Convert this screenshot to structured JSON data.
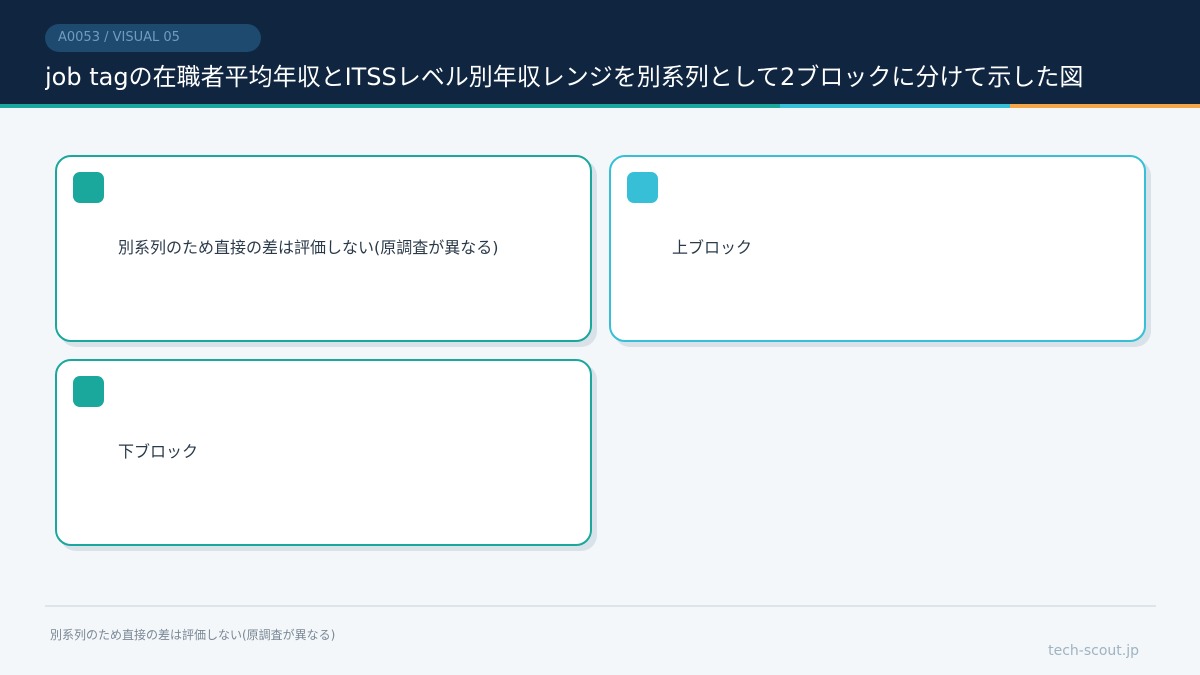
{
  "header": {
    "badge": "A0053 / VISUAL 05",
    "title": "job tagの在職者平均年収とITSSレベル別年収レンジを別系列として2ブロックに分けて示した図"
  },
  "cards": [
    {
      "text": "別系列のため直接の差は評価しない(原調査が異なる)"
    },
    {
      "text": "上ブロック"
    },
    {
      "text": "下ブロック"
    }
  ],
  "footer": {
    "note": "別系列のため直接の差は評価しない(原調査が異なる)",
    "brand": "tech-scout.jp"
  },
  "colors": {
    "header_bg": "#0f2540",
    "teal": "#1aa79c",
    "cyan": "#36bfd6",
    "orange": "#f3a64a"
  }
}
